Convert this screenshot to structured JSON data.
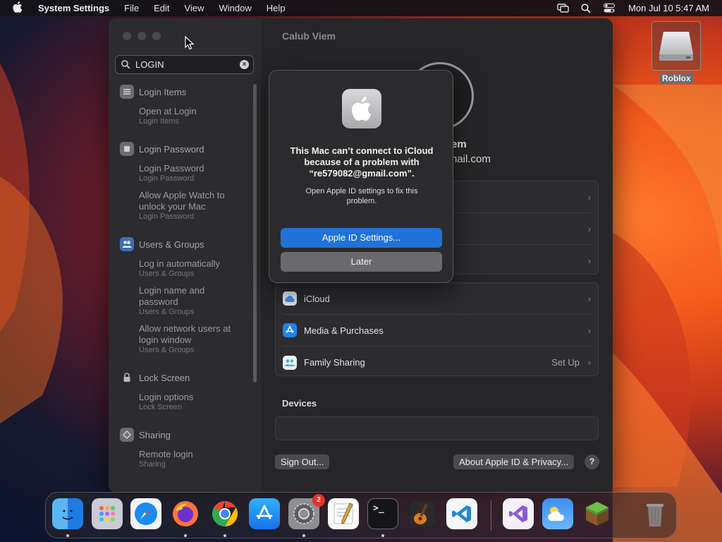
{
  "menubar": {
    "app_name": "System Settings",
    "items": [
      "File",
      "Edit",
      "View",
      "Window",
      "Help"
    ],
    "clock": "Mon Jul 10  5:47 AM"
  },
  "sidebar": {
    "search_value": "LOGIN",
    "groups": [
      {
        "title": "Login Items",
        "subs": [
          {
            "label": "Open at Login",
            "detail": "Login Items"
          }
        ]
      },
      {
        "title": "Login Password",
        "subs": [
          {
            "label": "Login Password",
            "detail": "Login Password"
          },
          {
            "label": "Allow Apple Watch to unlock your Mac",
            "detail": "Login Password"
          }
        ]
      },
      {
        "title": "Users & Groups",
        "subs": [
          {
            "label": "Log in automatically",
            "detail": "Users & Groups"
          },
          {
            "label": "Login name and password",
            "detail": "Users & Groups"
          },
          {
            "label": "Allow network users at login window",
            "detail": "Users & Groups"
          }
        ]
      },
      {
        "title": "Lock Screen",
        "subs": [
          {
            "label": "Login options",
            "detail": "Lock Screen"
          }
        ]
      },
      {
        "title": "Sharing",
        "subs": [
          {
            "label": "Remote login",
            "detail": "Sharing"
          }
        ]
      }
    ]
  },
  "content": {
    "title": "Calub Viem",
    "name_fragment": "em",
    "email_fragment": "nail.com",
    "services": [
      {
        "label": "iCloud",
        "value": ""
      },
      {
        "label": "Media & Purchases",
        "value": ""
      },
      {
        "label": "Family Sharing",
        "value": "Set Up"
      }
    ],
    "devices_label": "Devices",
    "sign_out": "Sign Out...",
    "about": "About Apple ID & Privacy...",
    "help": "?"
  },
  "dialog": {
    "title": "This Mac can’t connect to iCloud because of a problem with “re579082@gmail.com”.",
    "message": "Open Apple ID settings to fix this problem.",
    "primary": "Apple ID Settings...",
    "secondary": "Later"
  },
  "desktop": {
    "drive_label": "Roblox"
  },
  "dock": {
    "settings_badge": "2",
    "items": [
      "finder-icon",
      "launchpad-icon",
      "safari-icon",
      "firefox-icon",
      "chrome-icon",
      "app-store-icon",
      "system-settings-icon",
      "textedit-icon",
      "terminal-icon",
      "garageband-icon",
      "vscode-icon",
      "visual-studio-icon",
      "weather-icon",
      "minecraft-icon",
      "trash-icon"
    ]
  },
  "colors": {
    "accent_blue": "#1f72d9",
    "badge_red": "#e5322b"
  }
}
